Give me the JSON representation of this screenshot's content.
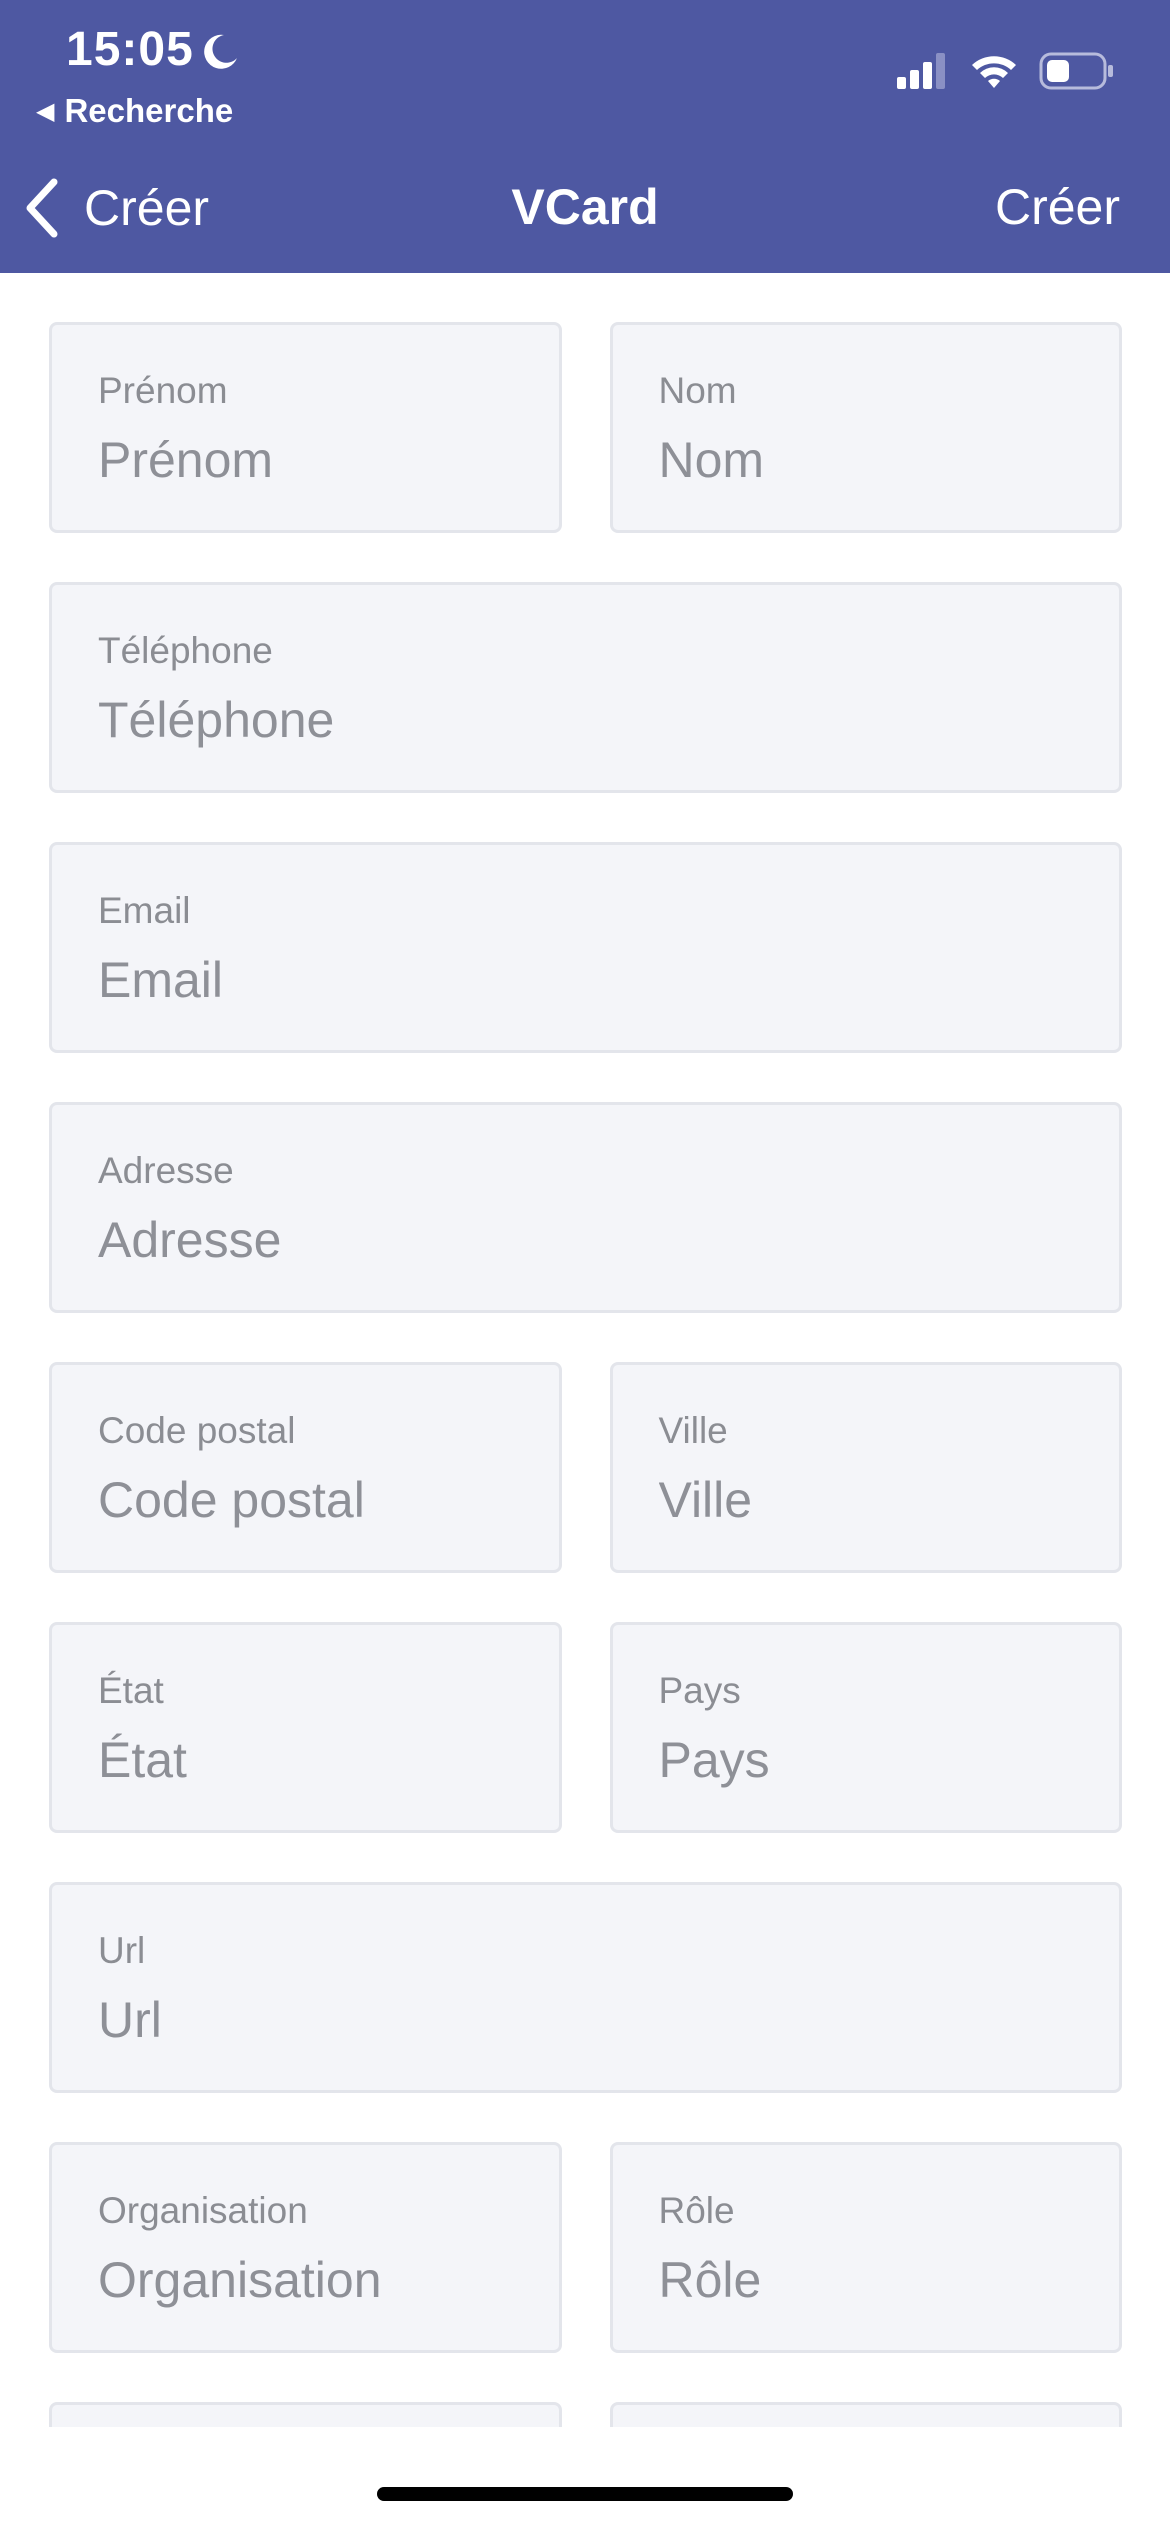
{
  "status_bar": {
    "time": "15:05",
    "back_app": "Recherche"
  },
  "nav": {
    "back_label": "Créer",
    "title": "VCard",
    "action_label": "Créer"
  },
  "fields": {
    "first_name": {
      "label": "Prénom",
      "placeholder": "Prénom",
      "value": ""
    },
    "last_name": {
      "label": "Nom",
      "placeholder": "Nom",
      "value": ""
    },
    "phone": {
      "label": "Téléphone",
      "placeholder": "Téléphone",
      "value": ""
    },
    "email": {
      "label": "Email",
      "placeholder": "Email",
      "value": ""
    },
    "address": {
      "label": "Adresse",
      "placeholder": "Adresse",
      "value": ""
    },
    "postal_code": {
      "label": "Code postal",
      "placeholder": "Code postal",
      "value": ""
    },
    "city": {
      "label": "Ville",
      "placeholder": "Ville",
      "value": ""
    },
    "state": {
      "label": "État",
      "placeholder": "État",
      "value": ""
    },
    "country": {
      "label": "Pays",
      "placeholder": "Pays",
      "value": ""
    },
    "url": {
      "label": "Url",
      "placeholder": "Url",
      "value": ""
    },
    "organisation": {
      "label": "Organisation",
      "placeholder": "Organisation",
      "value": ""
    },
    "role": {
      "label": "Rôle",
      "placeholder": "Rôle",
      "value": ""
    }
  },
  "colors": {
    "header_bg": "#4e58a2",
    "field_bg": "#f4f5f9",
    "field_border": "#e3e5eb",
    "label_text": "#8b8d93"
  },
  "icons": [
    "moon-icon",
    "back-triangle-icon",
    "signal-icon",
    "wifi-icon",
    "battery-icon",
    "chevron-left-icon"
  ]
}
